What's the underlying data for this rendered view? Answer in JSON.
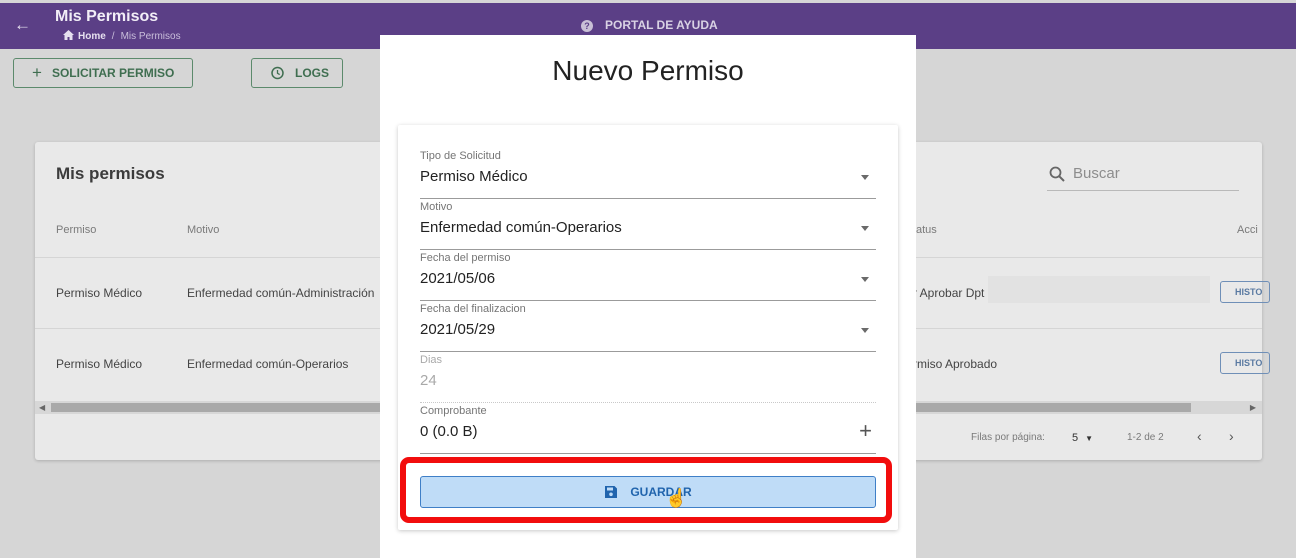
{
  "appbar": {
    "title": "Mis Permisos",
    "breadcrumb_home": "Home",
    "breadcrumb_sep": "/",
    "breadcrumb_current": "Mis Permisos",
    "help_label": "PORTAL DE AYUDA"
  },
  "toolbar": {
    "request_label": "SOLICITAR PERMISO",
    "logs_label": "LOGS"
  },
  "card": {
    "title": "Mis permisos",
    "search_placeholder": "Buscar",
    "headers": {
      "permiso": "Permiso",
      "motivo": "Motivo",
      "status": "atus",
      "acciones": "Acci"
    },
    "rows": [
      {
        "permiso": "Permiso Médico",
        "motivo": "Enfermedad común-Administración",
        "status": "r Aprobar Dpt",
        "action": "HISTO"
      },
      {
        "permiso": "Permiso Médico",
        "motivo": "Enfermedad común-Operarios",
        "status": "rmiso Aprobado",
        "action": "HISTO"
      }
    ],
    "pager": {
      "rows_label": "Filas por página:",
      "rows_value": "5",
      "range": "1-2 de 2"
    }
  },
  "modal": {
    "title": "Nuevo Permiso",
    "fields": [
      {
        "label": "Tipo de Solicitud",
        "value": "Permiso Médico"
      },
      {
        "label": "Motivo",
        "value": "Enfermedad común-Operarios"
      },
      {
        "label": "Fecha del permiso",
        "value": "2021/05/06"
      },
      {
        "label": "Fecha del finalizacion",
        "value": "2021/05/29"
      },
      {
        "label": "Dias",
        "value": "24"
      },
      {
        "label": "Comprobante",
        "value": "0 (0.0 B)"
      }
    ],
    "save_label": "GUARDAR"
  },
  "colors": {
    "appbar": "#5b3f86",
    "highlight": "#f20d0d",
    "save_fill": "#bfdcf7",
    "save_border": "#3f7fc7"
  }
}
